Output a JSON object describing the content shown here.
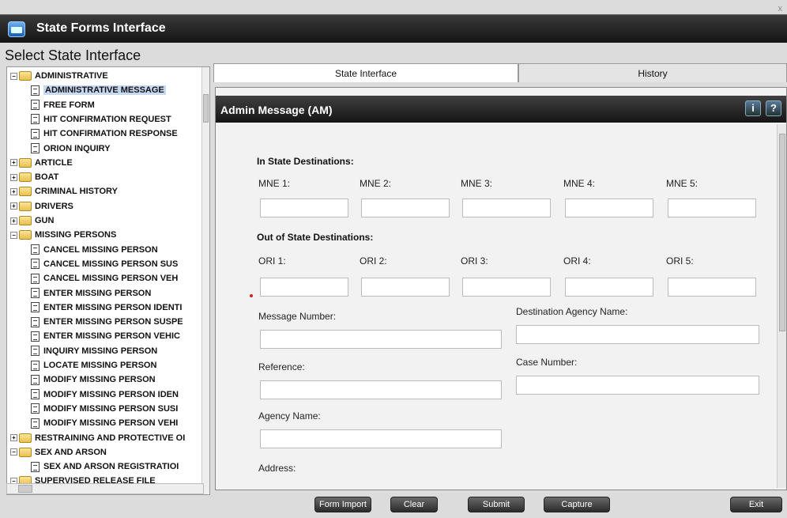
{
  "window": {
    "title": "State Forms Interface",
    "close": "x"
  },
  "select_label": "Select State Interface",
  "tree": [
    {
      "label": "ADMINISTRATIVE",
      "type": "folder",
      "expanded": true,
      "level": 0
    },
    {
      "label": "ADMINISTRATIVE MESSAGE",
      "type": "doc",
      "level": 1,
      "selected": true
    },
    {
      "label": "FREE FORM",
      "type": "doc",
      "level": 1
    },
    {
      "label": "HIT CONFIRMATION REQUEST",
      "type": "doc",
      "level": 1
    },
    {
      "label": "HIT CONFIRMATION RESPONSE",
      "type": "doc",
      "level": 1
    },
    {
      "label": "ORION INQUIRY",
      "type": "doc",
      "level": 1
    },
    {
      "label": "ARTICLE",
      "type": "folder",
      "level": 0
    },
    {
      "label": "BOAT",
      "type": "folder",
      "level": 0
    },
    {
      "label": "CRIMINAL HISTORY",
      "type": "folder",
      "level": 0
    },
    {
      "label": "DRIVERS",
      "type": "folder",
      "level": 0
    },
    {
      "label": "GUN",
      "type": "folder",
      "level": 0
    },
    {
      "label": "MISSING PERSONS",
      "type": "folder",
      "expanded": true,
      "level": 0
    },
    {
      "label": "CANCEL MISSING PERSON",
      "type": "doc",
      "level": 1
    },
    {
      "label": "CANCEL MISSING PERSON SUS",
      "type": "doc",
      "level": 1
    },
    {
      "label": "CANCEL MISSING PERSON VEH",
      "type": "doc",
      "level": 1
    },
    {
      "label": "ENTER MISSING PERSON",
      "type": "doc",
      "level": 1
    },
    {
      "label": "ENTER MISSING PERSON IDENTI",
      "type": "doc",
      "level": 1
    },
    {
      "label": "ENTER MISSING PERSON SUSPE",
      "type": "doc",
      "level": 1
    },
    {
      "label": "ENTER MISSING PERSON VEHIC",
      "type": "doc",
      "level": 1
    },
    {
      "label": "INQUIRY MISSING PERSON",
      "type": "doc",
      "level": 1
    },
    {
      "label": "LOCATE MISSING PERSON",
      "type": "doc",
      "level": 1
    },
    {
      "label": "MODIFY MISSING PERSON",
      "type": "doc",
      "level": 1
    },
    {
      "label": "MODIFY MISSING PERSON IDEN",
      "type": "doc",
      "level": 1
    },
    {
      "label": "MODIFY MISSING PERSON SUSI",
      "type": "doc",
      "level": 1
    },
    {
      "label": "MODIFY MISSING PERSON VEHI",
      "type": "doc",
      "level": 1
    },
    {
      "label": "RESTRAINING AND PROTECTIVE OI",
      "type": "folder",
      "level": 0
    },
    {
      "label": "SEX AND ARSON",
      "type": "folder",
      "expanded": true,
      "level": 0
    },
    {
      "label": "SEX AND ARSON REGISTRATIOI",
      "type": "doc",
      "level": 1
    },
    {
      "label": "SUPERVISED RELEASE FILE",
      "type": "folder",
      "expanded": true,
      "level": 0
    }
  ],
  "tabs": {
    "state": "State Interface",
    "history": "History"
  },
  "form": {
    "title": "Admin Message (AM)",
    "info_icon": "i",
    "help_icon": "?",
    "in_state_heading": "In State Destinations:",
    "mne_labels": [
      "MNE 1:",
      "MNE 2:",
      "MNE 3:",
      "MNE 4:",
      "MNE 5:"
    ],
    "out_state_heading": "Out of State Destinations:",
    "ori_labels": [
      "ORI 1:",
      "ORI 2:",
      "ORI 3:",
      "ORI 4:",
      "ORI 5:"
    ],
    "message_number": "Message Number:",
    "destination_agency": "Destination Agency Name:",
    "reference": "Reference:",
    "case_number": "Case Number:",
    "agency_name": "Agency Name:",
    "address": "Address:"
  },
  "buttons": {
    "form_import": "Form Import",
    "clear": "Clear",
    "submit": "Submit",
    "capture": "Capture",
    "exit": "Exit"
  }
}
